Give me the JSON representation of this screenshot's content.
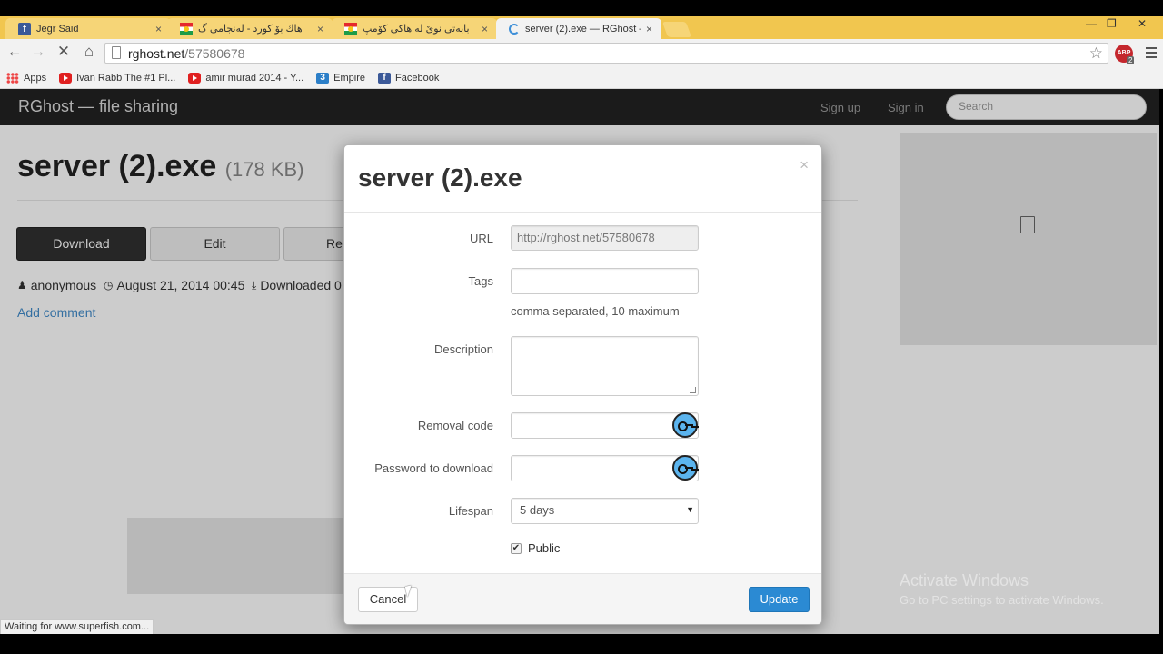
{
  "browser": {
    "tabs": [
      {
        "title": "Jegr Said",
        "favicon": "facebook-icon",
        "active": false
      },
      {
        "title": "هاك بۆ كورد - لەنجامی گ",
        "favicon": "kurdistan-flag-icon",
        "active": false
      },
      {
        "title": "بابەتی نوێ لە هاکی کۆمپ",
        "favicon": "kurdistan-flag-icon",
        "active": false
      },
      {
        "title": "server (2).exe — RGhost —",
        "favicon": "loading-spinner-icon",
        "active": true
      }
    ],
    "tab_close_glyph": "×",
    "url_host": "rghost.net",
    "url_path": "/57580678",
    "abp_label": "ABP",
    "abp_count": "2",
    "bookmarks": [
      {
        "label": "Apps",
        "icon": "apps-grid-icon"
      },
      {
        "label": "Ivan Rabb The #1 Pl...",
        "icon": "youtube-icon"
      },
      {
        "label": "amir murad 2014 - Y...",
        "icon": "youtube-icon"
      },
      {
        "label": "Empire",
        "icon": "empire-icon"
      },
      {
        "label": "Facebook",
        "icon": "facebook-icon"
      }
    ],
    "status_text": "Waiting for www.superfish.com..."
  },
  "site": {
    "brand": "RGhost — file sharing",
    "nav": {
      "signup": "Sign up",
      "signin": "Sign in",
      "search_placeholder": "Search"
    },
    "file": {
      "name": "server (2).exe",
      "size": "(178 KB)",
      "buttons": {
        "download": "Download",
        "edit": "Edit",
        "remove": "Re"
      },
      "author": "anonymous",
      "date": "August 21, 2014 00:45",
      "downloaded": "Downloaded 0",
      "add_comment": "Add comment"
    }
  },
  "modal": {
    "title": "server (2).exe",
    "close_glyph": "×",
    "labels": {
      "url": "URL",
      "tags": "Tags",
      "description": "Description",
      "removal_code": "Removal code",
      "password": "Password to download",
      "lifespan": "Lifespan"
    },
    "values": {
      "url": "http://rghost.net/57580678",
      "tags": "",
      "description": "",
      "removal_code": "",
      "password": "",
      "lifespan": "5 days"
    },
    "tags_help": "comma separated, 10 maximum",
    "public_label": "Public",
    "public_checked": true,
    "buttons": {
      "cancel": "Cancel",
      "update": "Update"
    }
  },
  "watermark": {
    "title": "Activate Windows",
    "subtitle": "Go to PC settings to activate Windows."
  },
  "colors": {
    "tabstrip": "#f1c64f",
    "navbar": "#222222",
    "primary_button": "#2b8ad3",
    "link": "#428bca"
  }
}
